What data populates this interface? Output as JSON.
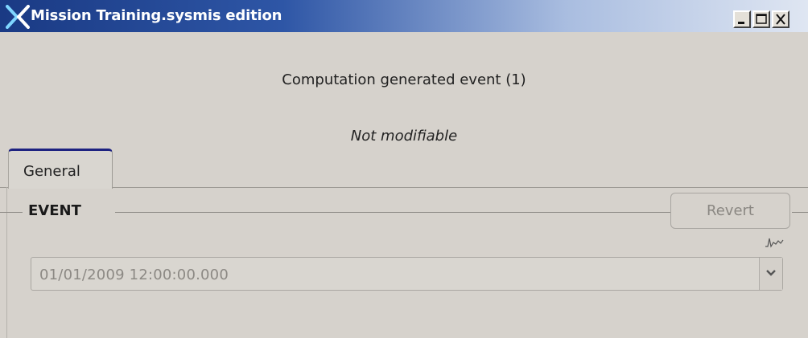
{
  "window": {
    "title": "Mission Training.sysmis edition",
    "controls": {
      "minimize": "minimize-icon",
      "maximize": "maximize-icon",
      "close": "close-icon"
    }
  },
  "header": {
    "title": "Computation generated event (1)",
    "subtitle": "Not modifiable"
  },
  "tabs": [
    {
      "label": "General",
      "active": true
    }
  ],
  "event_group": {
    "label": "EVENT",
    "revert_label": "Revert",
    "graph_icon": "graph-icon",
    "date_value": "01/01/2009 12:00:00.000",
    "dropdown_icon": "chevron-down-icon"
  },
  "colors": {
    "titlebar_start": "#1a3a84",
    "tab_accent": "#1d2280",
    "background": "#d6d2cc",
    "disabled_text": "#8c8984"
  }
}
